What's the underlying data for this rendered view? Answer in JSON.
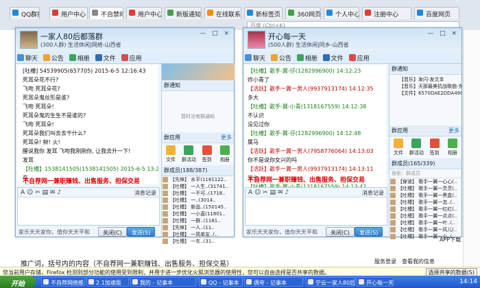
{
  "browser": {
    "tabs": [
      "QQ群搜索",
      "用户中心",
      "不自禁网...",
      "用户中心",
      "新版通知",
      "在线联系",
      "新标签页",
      "360网页",
      "个人中心",
      "注册中心",
      "百度网页"
    ],
    "address_text": "百度 (Ctrl+K)",
    "bottom_text": "推广词，括号内的内容（不自荐网一兼职赚钱、出售服务、担保交易）",
    "infobar_text": "您当前用户存储，Firefox 检测到部分功能的使用受到限制，并用于进一步优化火狐浏览器的使用性，您可以自由选择是否共享的数据。",
    "infobar_button": "选择共享的数据(S)",
    "right_labels": [
      "APP下载",
      "服务登录",
      "查看我的信息"
    ]
  },
  "left_window": {
    "title": "一家人80后都落群",
    "subtitle": "(300人群) 生活休闲|网络-山西省",
    "window_buttons": "— □ ×",
    "tools": [
      "聊天",
      "公告",
      "相册",
      "文件",
      "应用"
    ],
    "messages": [
      {
        "kind": "m",
        "text": "[吐槽] 54539905(657705)  2015-6-5 12:16:43"
      },
      {
        "kind": "m",
        "text": "死耳朵花不行?"
      },
      {
        "kind": "m",
        "text": "飞吻 死耳朵花?"
      },
      {
        "kind": "m",
        "text": "死耳朵鬼丝形是谁?"
      },
      {
        "kind": "m",
        "text": "飞吻 死耳朵!"
      },
      {
        "kind": "m",
        "text": "死耳朵鬼的生生不是谁的?"
      },
      {
        "kind": "m",
        "text": "飞吻 死耳朵!"
      },
      {
        "kind": "m",
        "text": "死耳朵我们叫去去干什么?"
      },
      {
        "kind": "m",
        "text": "死耳朵! 鲜! 火!"
      },
      {
        "kind": "m",
        "text": "醒说我你 发耳 飞吻我刚刚你, 让我去升一下!"
      },
      {
        "kind": "m",
        "text": "发耳"
      },
      {
        "kind": "s",
        "text": "【吐槽】1538141505(1538141505)  2015-6-5 13:29:08"
      },
      {
        "kind": "m",
        "text": "在"
      },
      {
        "kind": "s",
        "text": "【吐槽】不自禁网(2191309999)  14:14:02"
      }
    ],
    "red_text": "不自荐网一兼职赚钱、出售服务、担保交易",
    "input_toolbar": "A ☺ ✂ ▤ ✉ ♪",
    "history_label": "消息记录",
    "footer_text": "家乐天天家你，值你天天平和",
    "close_button": "关闭(C)",
    "send_button": "发送(S)",
    "side_header": "群通知",
    "side_empty": "暂时没有群通知",
    "apps_header": "群应用",
    "apps_more": "更多",
    "apps": [
      "文件",
      "群活动",
      "签到",
      "相册"
    ],
    "members_header": "群成员(188/387)",
    "members": [
      "【先锋】 水平(1181122..",
      "【吐槽】 一人生..(31741..",
      "【吐槽】 一不可..(1718..",
      "【吐槽】 一..(3014..",
      "【吐槽】 新品..(150145..",
      "【吐槽】 一小直(11801..",
      "【吐槽】 一群..(1181..",
      "【先锋】 一人..(11..",
      "【吐槽】 一简单友..(..",
      "【吐槽】 一东..(31.."
    ]
  },
  "right_window": {
    "title": "开心每一天",
    "subtitle": "(500人群) 生活休闲|同乡-山西省",
    "window_buttons": "— □ ×",
    "tools": [
      "聊天",
      "公告",
      "相册",
      "文件",
      "应用"
    ],
    "messages": [
      {
        "kind": "s",
        "text": "【吐槽】歌手-翼-仔(1282996900)  14:12:23"
      },
      {
        "kind": "m",
        "text": "炸小青了"
      },
      {
        "kind": "r",
        "text": "【活跃】歌手一翼一男人(9937913174)  14:12:35"
      },
      {
        "kind": "m",
        "text": "多大"
      },
      {
        "kind": "s",
        "text": "【吐槽】歌手-翼-小青(1318167559)  14:12:38"
      },
      {
        "kind": "m",
        "text": "不认识"
      },
      {
        "kind": "m",
        "text": "没见过你"
      },
      {
        "kind": "s",
        "text": "【吐槽】歌手-翼-仔(1282996900)  14:12:48"
      },
      {
        "kind": "m",
        "text": "属马"
      },
      {
        "kind": "r",
        "text": "【活跃】歌手一翼一男人(7958776064)  14:13:03"
      },
      {
        "kind": "m",
        "text": "你不是说你女兴的吗"
      },
      {
        "kind": "r",
        "text": "【活跃】歌手一翼一男人(9937913174)  14:13:11"
      },
      {
        "kind": "m",
        "text": "三七"
      },
      {
        "kind": "s",
        "text": "【吐槽】歌手-翼-小青(1318167559)  14:13:42"
      },
      {
        "kind": "m",
        "text": "喝好喝好看了，我又没见过你，满90后认识你"
      },
      {
        "kind": "r",
        "text": "【活跃】歌手一翼一男人(9937913174)  14:13:44"
      },
      {
        "kind": "m",
        "text": "傻罗38"
      },
      {
        "kind": "s",
        "text": "【吐槽】不自禁网(2191309999)  14:14:02"
      }
    ],
    "red_text": "不自荐网一兼职赚钱、出售服务、担保交易",
    "input_toolbar": "A ☺ ✂ ▤ ✉ ♪",
    "history_label": "消息记录",
    "footer_text": "家乐天天家你，值你天天平和",
    "close_button": "关闭(C)",
    "send_button": "发送(S)",
    "side_header": "群通知",
    "notices": [
      "【音乐】发闪-发文本",
      "【音乐】天那最美抗战歌曲-东兰..",
      "【文件】6570DAE2DDA4902E19.."
    ],
    "apps_header": "群应用",
    "apps_more": "更多",
    "apps": [
      "文件",
      "群活动",
      "签到",
      "相册"
    ],
    "members_header": "群成员(165/339)",
    "members_search": "搜索：群成员",
    "members": [
      "【穿波】 歌手一翼一心心(..",
      "【吐槽】 歌手一翼一灵灵(..",
      "【吐槽】 歌手一翼一黑盒(..",
      "【吐槽】 歌手一翼一怎..(..",
      "【吐槽】 歌手一翼一红红(..",
      "【吐槽】 歌手一翼一点点(..",
      "【吐槽】 歌手一翼一叶..(..",
      "【吐槽】 歌手一翼一风儿(..",
      "【吐槽】 歌手一翼一小..(.."
    ]
  },
  "taskbar": {
    "start": "开始",
    "items": [
      "不自荐网络推...",
      "2.1加速版",
      "我的 - 记事本",
      "QQ - 记事本",
      "偶夸 - 记事本",
      "宁云一家人80后...",
      "开心每一天"
    ],
    "clock": "14:14"
  },
  "colors": {
    "accent": "#2f7ccc",
    "red_text": "#e00000",
    "taskbar": "#2356c6"
  }
}
